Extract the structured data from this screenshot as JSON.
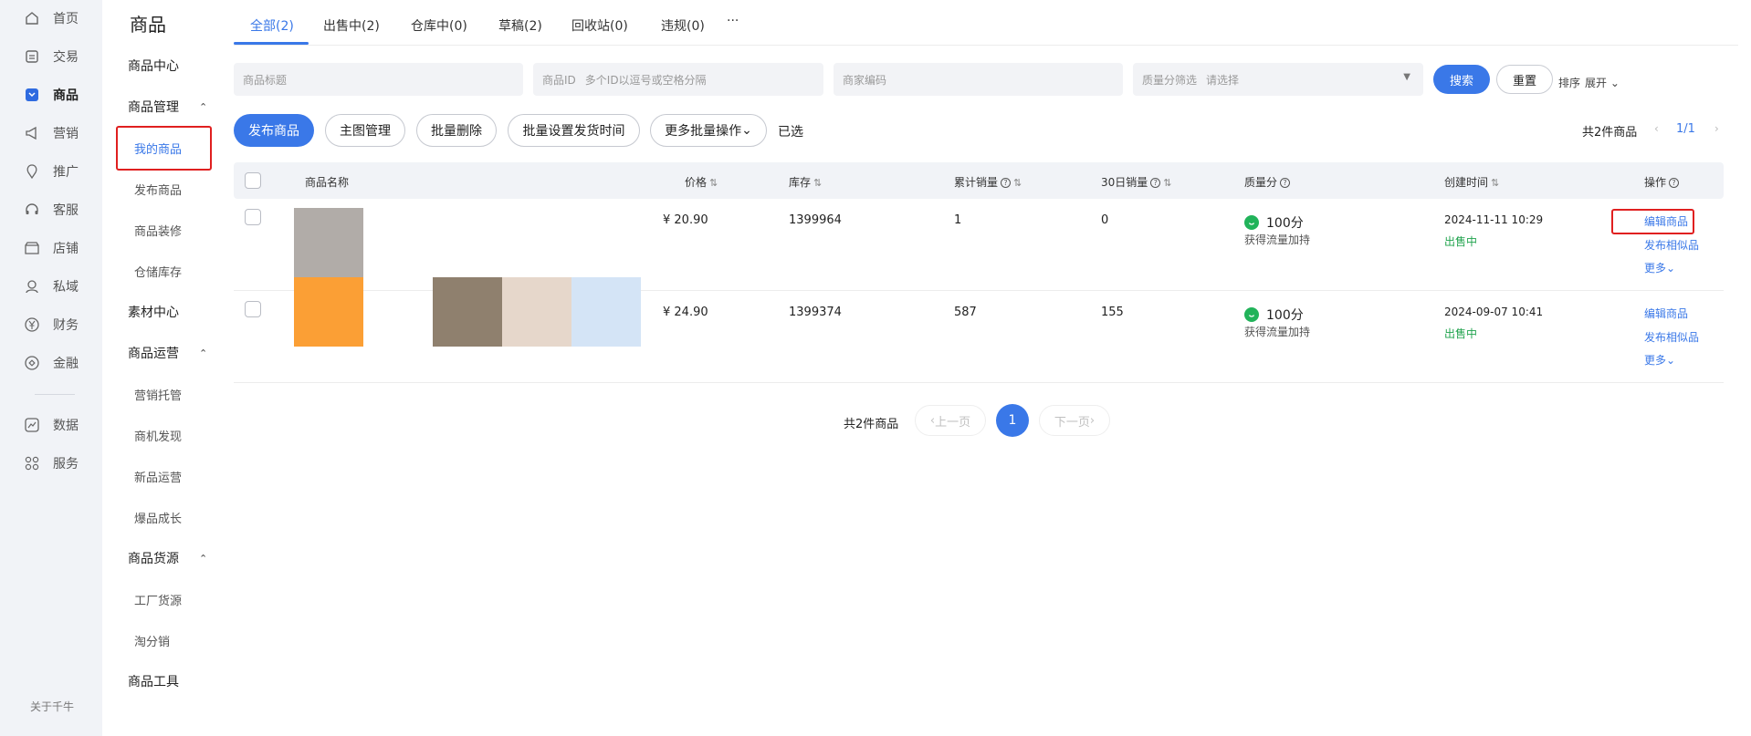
{
  "nav": {
    "items": [
      {
        "icon": "home-icon",
        "label": "首页"
      },
      {
        "icon": "trade-icon",
        "label": "交易"
      },
      {
        "icon": "product-icon",
        "label": "商品"
      },
      {
        "icon": "megaphone-icon",
        "label": "营销"
      },
      {
        "icon": "promote-icon",
        "label": "推广"
      },
      {
        "icon": "headset-icon",
        "label": "客服"
      },
      {
        "icon": "store-icon",
        "label": "店铺"
      },
      {
        "icon": "private-domain-icon",
        "label": "私域"
      },
      {
        "icon": "yuan-icon",
        "label": "财务"
      },
      {
        "icon": "finance-icon",
        "label": "金融"
      },
      {
        "icon": "chart-icon",
        "label": "数据"
      },
      {
        "icon": "grid-icon",
        "label": "服务"
      }
    ],
    "about": "关于千牛"
  },
  "subnav": {
    "title": "商品",
    "product_center": "商品中心",
    "product_mgmt": "商品管理",
    "my_products": "我的商品",
    "publish_product": "发布商品",
    "product_decor": "商品装修",
    "warehouse": "仓储库存",
    "material_center": "素材中心",
    "product_ops": "商品运营",
    "marketing_hosting": "营销托管",
    "opportunity": "商机发现",
    "new_product_ops": "新品运营",
    "hot_growth": "爆品成长",
    "product_supply": "商品货源",
    "factory_supply": "工厂货源",
    "taofenxiao": "淘分销",
    "product_tools": "商品工具"
  },
  "tabs": [
    "全部(2)",
    "出售中(2)",
    "仓库中(0)",
    "草稿(2)",
    "回收站(0)",
    "违规(0)",
    "···"
  ],
  "filters": {
    "title_placeholder": "商品标题",
    "id_label": "商品ID",
    "id_placeholder": "多个ID以逗号或空格分隔",
    "code_placeholder": "商家编码",
    "quality_label": "质量分筛选",
    "quality_placeholder": "请选择",
    "search": "搜索",
    "reset": "重置",
    "sort": "排序",
    "expand": "展开"
  },
  "actions": {
    "publish": "发布商品",
    "main_image": "主图管理",
    "batch_delete": "批量删除",
    "batch_ship_time": "批量设置发货时间",
    "more_batch": "更多批量操作",
    "selected": "已选",
    "total_top": "共2件商品",
    "page_mini": "1/1"
  },
  "table": {
    "headers": {
      "name": "商品名称",
      "price": "价格",
      "stock": "库存",
      "total_sales": "累计销量",
      "sales30": "30日销量",
      "quality": "质量分",
      "created": "创建时间",
      "ops": "操作"
    },
    "rows": [
      {
        "price": "¥ 20.90",
        "stock": "1399964",
        "total_sales": "1",
        "sales30": "0",
        "quality_score": "100分",
        "quality_note": "获得流量加持",
        "created": "2024-11-11 10:29",
        "status": "出售中",
        "edit": "编辑商品",
        "similar": "发布相似品",
        "more": "更多"
      },
      {
        "price": "¥ 24.90",
        "stock": "1399374",
        "total_sales": "587",
        "sales30": "155",
        "quality_score": "100分",
        "quality_note": "获得流量加持",
        "created": "2024-09-07 10:41",
        "status": "出售中",
        "edit": "编辑商品",
        "similar": "发布相似品",
        "more": "更多"
      }
    ]
  },
  "pagination": {
    "total": "共2件商品",
    "prev": "上一页",
    "current": "1",
    "next": "下一页"
  },
  "colors": {
    "accent": "#3a78e8",
    "highlight_box": "#e02020",
    "status_green": "#21a34e",
    "nav_bg": "#f1f3f7"
  }
}
